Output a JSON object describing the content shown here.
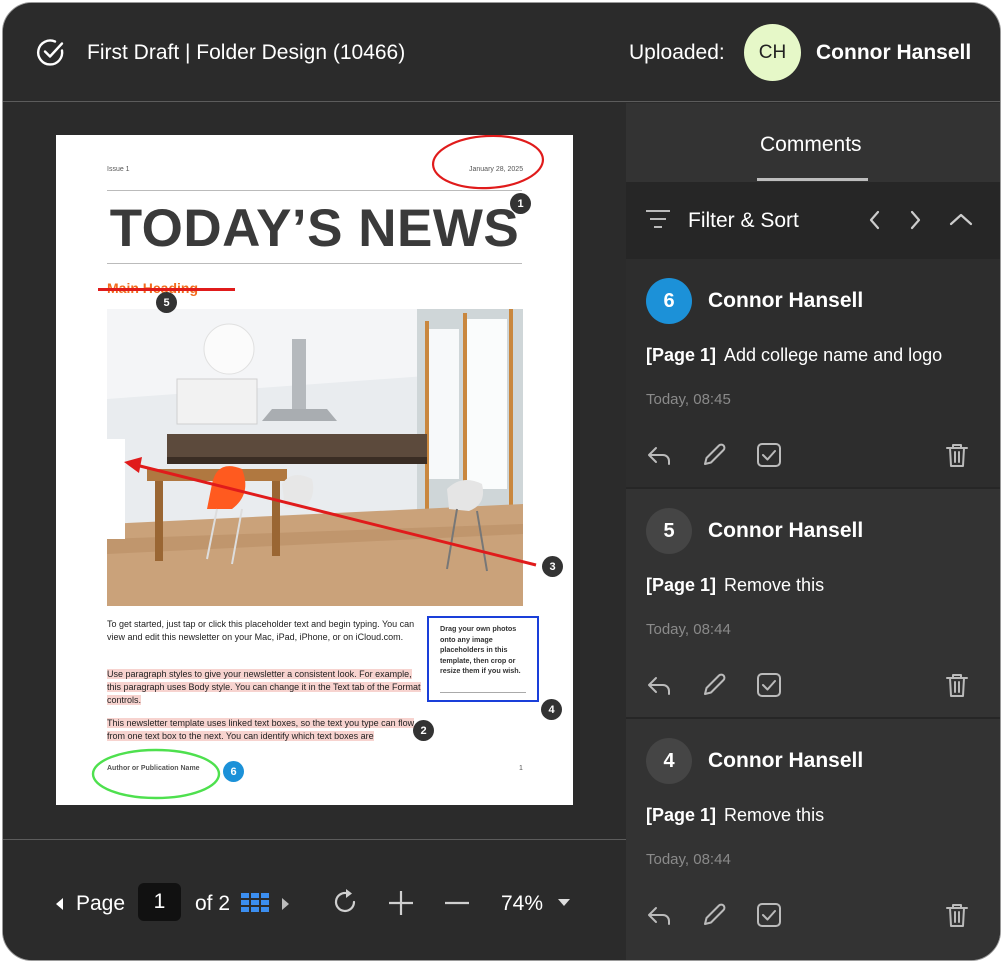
{
  "header": {
    "title": "First Draft | Folder Design (10466)",
    "uploaded_label": "Uploaded:",
    "avatar_initials": "CH",
    "uploader_name": "Connor Hansell"
  },
  "document": {
    "issue": "Issue 1",
    "date": "January 28, 2025",
    "headline": "TODAY’S NEWS",
    "main_heading": "Main Heading",
    "para1": "To get started, just tap or click this placeholder text and begin typing. You can view and edit this newsletter on your Mac, iPad, iPhone, or on iCloud.com.",
    "para2": "Use paragraph styles to give your newsletter a consistent look. For example, this paragraph uses Body style. You can change it in the Text tab of the Format controls.",
    "para3": "This newsletter template uses linked text boxes, so the text you type can flow from one text box to the next. You can identify which text boxes are",
    "sidebar_text": "Drag your own photos onto any image placeholders in this template, then crop or resize them if you wish.",
    "author": "Author or Publication Name",
    "page_number": "1",
    "markers": [
      "1",
      "2",
      "3",
      "4",
      "5",
      "6"
    ]
  },
  "toolbar": {
    "page_label": "Page",
    "page_value": "1",
    "of_label": "of 2",
    "zoom": "74%"
  },
  "panel": {
    "tab_label": "Comments",
    "filter_label": "Filter & Sort"
  },
  "comments": [
    {
      "number": "6",
      "author": "Connor Hansell",
      "page": "[Page 1]",
      "text": "Add college name and logo",
      "time": "Today, 08:45"
    },
    {
      "number": "5",
      "author": "Connor Hansell",
      "page": "[Page 1]",
      "text": "Remove this",
      "time": "Today, 08:44"
    },
    {
      "number": "4",
      "author": "Connor Hansell",
      "page": "[Page 1]",
      "text": "Remove this",
      "time": "Today, 08:44"
    }
  ],
  "colors": {
    "accent_blue": "#1c91d8",
    "annotation_red": "#e01b1b",
    "annotation_blue": "#1a3fd9",
    "annotation_green": "#4ee04e",
    "avatar_bg": "#e6f8c8"
  }
}
